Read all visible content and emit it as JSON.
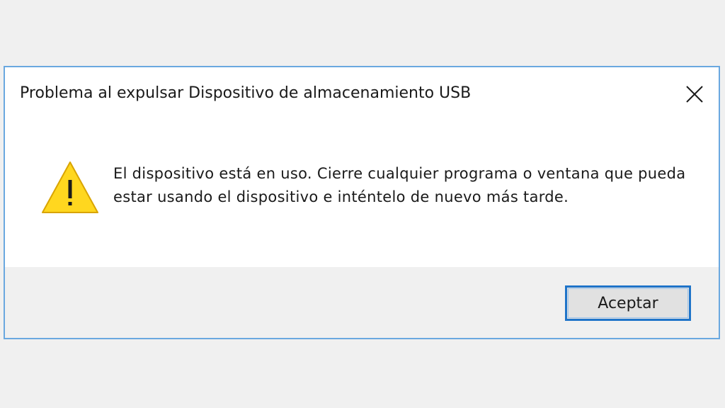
{
  "dialog": {
    "title": "Problema al expulsar Dispositivo de almacenamiento USB",
    "close_icon": "close-icon",
    "warning_icon": "warning-triangle-icon",
    "message": "El dispositivo está en uso. Cierre cualquier programa o ventana que pueda estar usando el dispositivo e inténtelo de nuevo más tarde.",
    "ok_label": "Aceptar"
  },
  "colors": {
    "background": "#f0f0f0",
    "dialog_border": "#6aa8e0",
    "button_border": "#1f74c9",
    "warning_fill": "#ffd71f"
  }
}
